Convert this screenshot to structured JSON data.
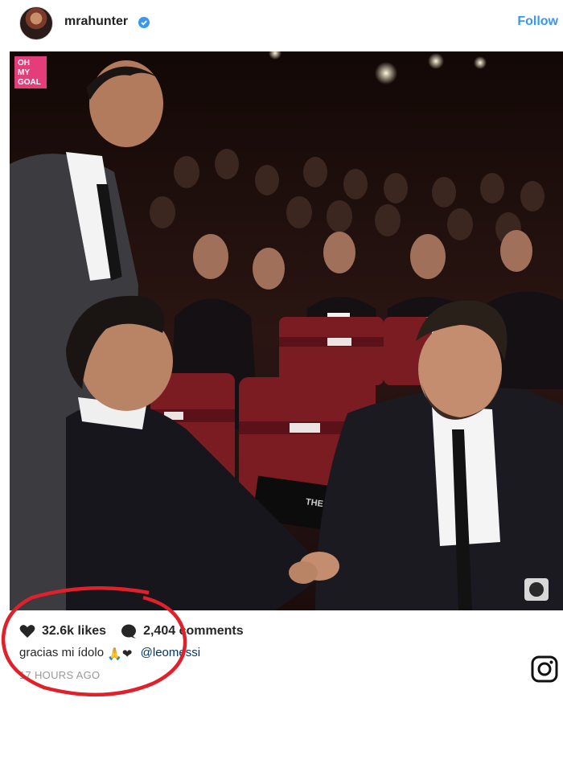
{
  "header": {
    "username": "mrahunter",
    "follow_label": "Follow",
    "avatar_icon": "profile-avatar",
    "verified_icon": "verified-badge-icon"
  },
  "photo": {
    "brand_line1": "OH",
    "brand_line2": "MY",
    "brand_line3": "GOAL",
    "program_title": "THE BEST"
  },
  "engagement": {
    "likes": "32.6k likes",
    "comments": "2,404 comments",
    "like_icon": "heart-icon",
    "comment_icon": "comment-icon"
  },
  "caption": {
    "text": "gracias mi ídolo",
    "emojis": "🙏❤",
    "mention": "@leomessi"
  },
  "timestamp": "17 HOURS AGO",
  "colors": {
    "link": "#3897f0",
    "mention": "#003569",
    "annotation": "#e0202a",
    "brand": "#e43d7a"
  }
}
